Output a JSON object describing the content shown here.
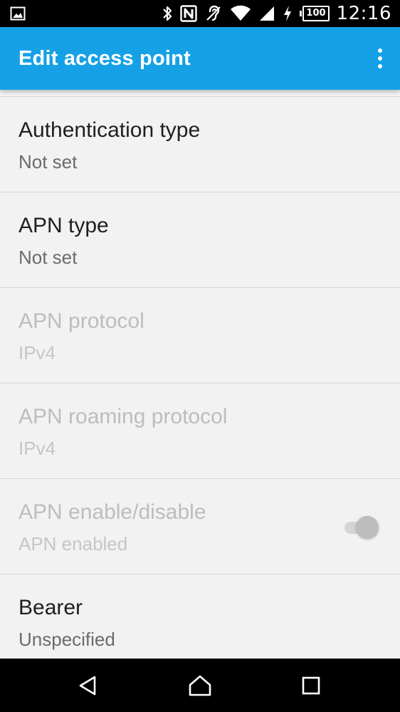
{
  "status_bar": {
    "battery_level": "100",
    "time": "12:16",
    "icons": [
      "image-notification-icon",
      "bluetooth-icon",
      "nfc-icon",
      "hearing-aid-icon",
      "wifi-icon",
      "cell-signal-icon",
      "charging-bolt-icon",
      "battery-icon"
    ]
  },
  "app_bar": {
    "title": "Edit access point",
    "overflow_icon": "more-vert-icon",
    "color": "#16a1e6"
  },
  "preferences": [
    {
      "title": "Authentication type",
      "summary": "Not set",
      "enabled": true
    },
    {
      "title": "APN type",
      "summary": "Not set",
      "enabled": true
    },
    {
      "title": "APN protocol",
      "summary": "IPv4",
      "enabled": false
    },
    {
      "title": "APN roaming protocol",
      "summary": "IPv4",
      "enabled": false
    },
    {
      "title": "APN enable/disable",
      "summary": "APN enabled",
      "enabled": false,
      "switch_on": true
    },
    {
      "title": "Bearer",
      "summary": "Unspecified",
      "enabled": true
    }
  ],
  "nav_bar": {
    "icons": [
      "back-icon",
      "home-icon",
      "recents-icon"
    ]
  }
}
